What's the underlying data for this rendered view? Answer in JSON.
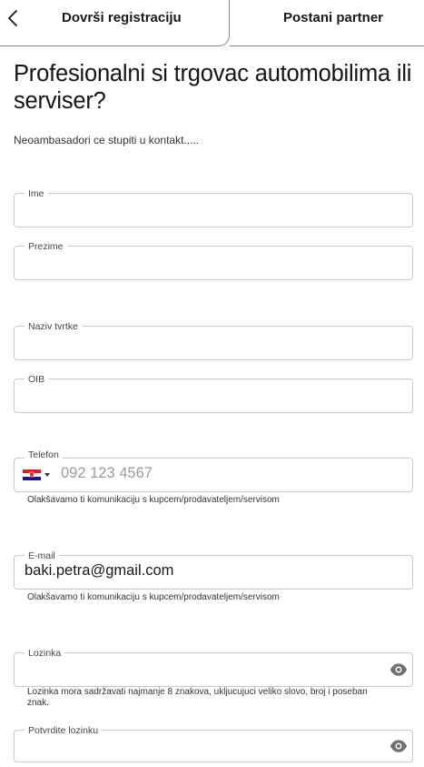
{
  "header": {
    "active_tab": "Dovrši registraciju",
    "other_tab": "Postani partner"
  },
  "title": "Profesionalni si trgovac automobilima ili serviser?",
  "subtitle": "Neoambasadori ce stupiti u kontakt.....",
  "form": {
    "ime": {
      "label": "Ime",
      "value": ""
    },
    "prezime": {
      "label": "Prezime",
      "value": ""
    },
    "naziv_tvrtke": {
      "label": "Naziv tvrtke",
      "value": ""
    },
    "oib": {
      "label": "OIB",
      "value": ""
    },
    "telefon": {
      "label": "Telefon",
      "placeholder": "092 123 4567",
      "helper": "Olakšavamo ti komunikaciju s kupcem/prodavateljem/servisom"
    },
    "email": {
      "label": "E-mail",
      "value": "baki.petra@gmail.com",
      "helper": "Olakšavamo ti komunikaciju s kupcem/prodavateljem/servisom"
    },
    "lozinka": {
      "label": "Lozinka",
      "value": "",
      "helper": "Lozinka mora sadržavati najmanje 8 znakova, ukljucujuci veliko slovo, broj i poseban znak."
    },
    "potvrdite_lozinku": {
      "label": "Potvrdite lozinku",
      "value": ""
    }
  },
  "icons": {
    "back": "chevron-left-icon",
    "flag": "croatia-flag-icon",
    "eye": "eye-icon"
  },
  "colors": {
    "border": "#c9c9c9",
    "text": "#1a1a1a",
    "placeholder": "#9a9a9a"
  }
}
